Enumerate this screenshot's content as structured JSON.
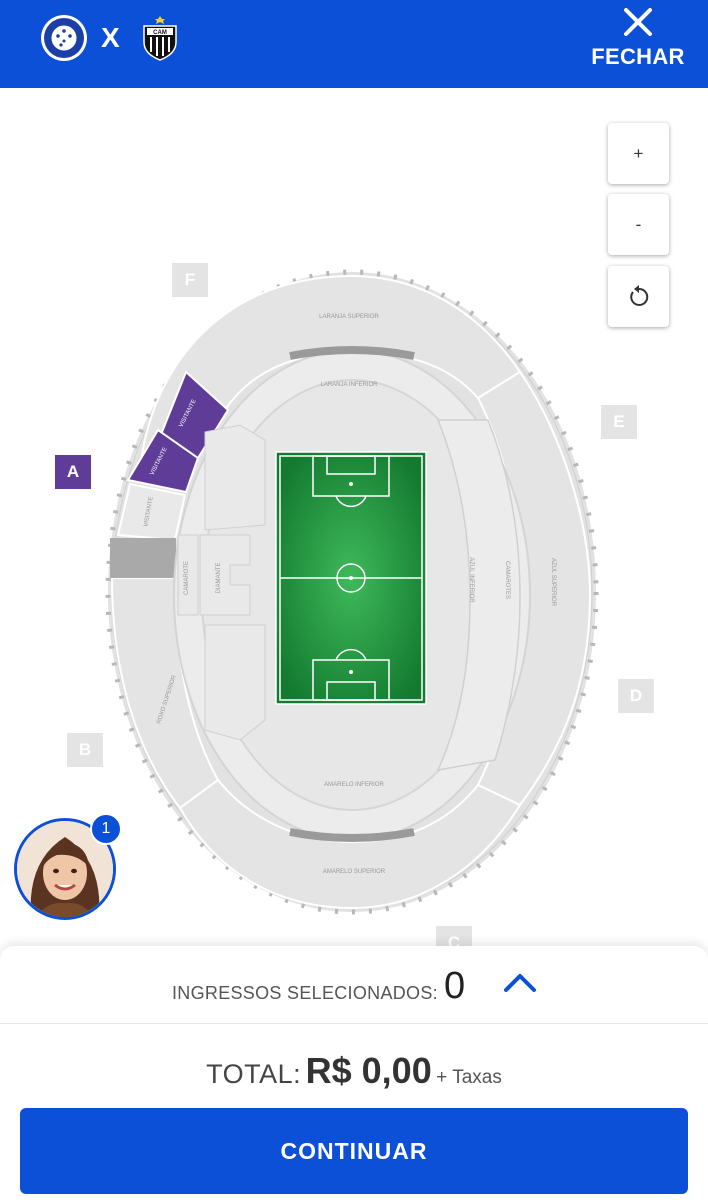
{
  "header": {
    "home_team": "Cruzeiro Esporte Clube",
    "home_crest_lettering": "CRUZEIRO ESPORTE CLUBE",
    "vs": "X",
    "away_team": "CAM",
    "close_label": "FECHAR",
    "brand_color": "#0b50d6"
  },
  "map": {
    "zoom_in": "+",
    "zoom_out": "-",
    "reset_icon": "reset-icon",
    "sector_letters": {
      "a": "A",
      "b": "B",
      "c": "C",
      "d": "D",
      "e": "E",
      "f": "F"
    },
    "sectors": {
      "laranja_superior": "LARANJA SUPERIOR",
      "laranja_inferior": "LARANJA INFERIOR",
      "visitante_1": "VISITANTE",
      "visitante_2": "VISITANTE",
      "visitante_3": "VISITANTE",
      "camarote_1": "CAMAROTE",
      "diamante": "DIAMANTE",
      "azul_inferior": "AZUL INFERIOR",
      "camarotes": "CAMAROTES",
      "azul_superior": "AZUL SUPERIOR",
      "roxo_superior": "ROXO SUPERIOR",
      "amarelo_inferior": "AMARELO INFERIOR",
      "amarelo_superior": "AMARELO SUPERIOR"
    },
    "visitor_color": "#5e3c98",
    "field_color": "#1f9a3e"
  },
  "chat": {
    "badge": "1"
  },
  "panel": {
    "selected_label": "INGRESSOS SELECIONADOS:",
    "selected_count": "0",
    "total_label": "TOTAL:",
    "total_value": "R$ 0,00",
    "taxes": "+ Taxas",
    "continue": "CONTINUAR"
  }
}
